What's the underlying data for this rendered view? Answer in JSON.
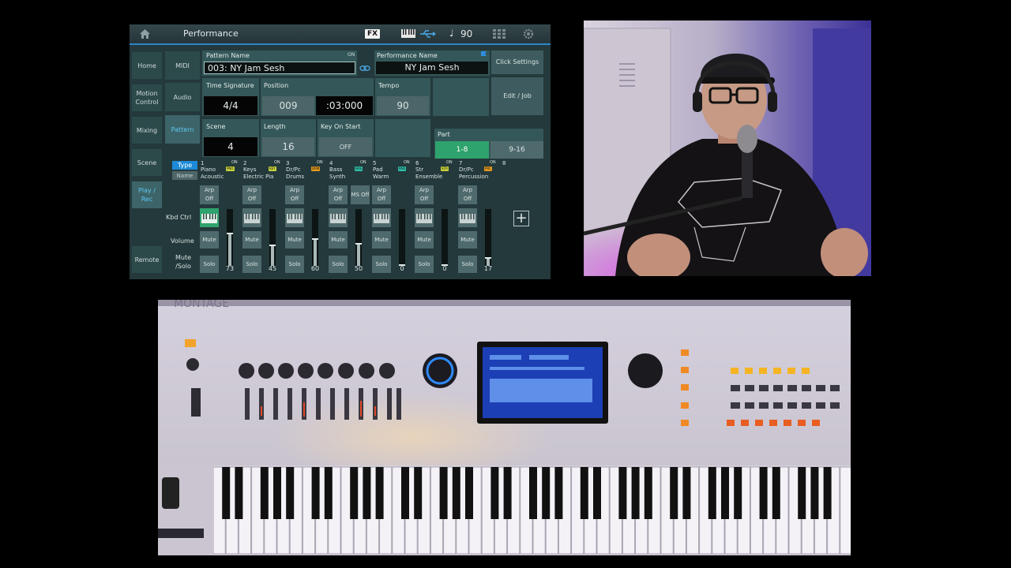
{
  "header": {
    "home_icon": "home-icon",
    "title": "Performance",
    "fx_label": "FX",
    "tempo": "90",
    "note_glyph": "♩"
  },
  "nav": {
    "primary": [
      "Home",
      "Motion Control",
      "Mixing",
      "Scene",
      "Play / Rec",
      "Remote"
    ],
    "secondary": [
      "MIDI",
      "Audio",
      "Pattern"
    ]
  },
  "fields": {
    "pattern_name_label": "Pattern Name",
    "pattern_name_value": "003: NY Jam Sesh",
    "performance_name_label": "Performance Name",
    "performance_name_value": "NY Jam Sesh",
    "time_signature_label": "Time Signature",
    "time_signature_value": "4/4",
    "position_label": "Position",
    "position_measure": "009",
    "position_time": ":03:000",
    "tempo_label": "Tempo",
    "tempo_value": "90",
    "scene_label": "Scene",
    "scene_value": "4",
    "length_label": "Length",
    "length_value": "16",
    "key_on_start_label": "Key On Start",
    "key_on_start_value": "OFF",
    "part_label": "Part",
    "part_1_8": "1-8",
    "part_9_16": "9-16",
    "on_tag": "ON"
  },
  "buttons": {
    "click_settings": "Click Settings",
    "edit_job": "Edit / Job",
    "type": "Type",
    "name": "Name"
  },
  "rows": {
    "kbd_ctrl": "Kbd Ctrl",
    "volume": "Volume",
    "mute_solo": "Mute /Solo",
    "arp": "Arp Off",
    "ms": "MS Off",
    "mute": "Mute",
    "solo": "Solo"
  },
  "parts": [
    {
      "num": "1",
      "line1": "Piano",
      "line2": "Acoustic",
      "tag": "PNO",
      "tag_color": "#c8d23c",
      "volume": "73",
      "vol_level": 73
    },
    {
      "num": "2",
      "line1": "Keys",
      "line2": "Electric Pia",
      "tag": "KEY",
      "tag_color": "#c8d23c",
      "volume": "45",
      "vol_level": 45
    },
    {
      "num": "3",
      "line1": "Dr/Pc",
      "line2": "Drums",
      "tag": "DRM",
      "tag_color": "#e69a1e",
      "volume": "60",
      "vol_level": 60
    },
    {
      "num": "4",
      "line1": "Bass",
      "line2": "Synth",
      "tag": "BAS",
      "tag_color": "#2fbfa8",
      "volume": "50",
      "vol_level": 50
    },
    {
      "num": "5",
      "line1": "Pad",
      "line2": "Warm",
      "tag": "PAD",
      "tag_color": "#2fbfa8",
      "volume": "0",
      "vol_level": 0
    },
    {
      "num": "6",
      "line1": "Str",
      "line2": "Ensemble",
      "tag": "STR",
      "tag_color": "#c8d23c",
      "volume": "0",
      "vol_level": 0
    },
    {
      "num": "7",
      "line1": "Dr/Pc",
      "line2": "Percussion",
      "tag": "PRC",
      "tag_color": "#e69a1e",
      "volume": "17",
      "vol_level": 17
    },
    {
      "num": "8"
    }
  ],
  "keyboard_brand": "MONTAGE"
}
